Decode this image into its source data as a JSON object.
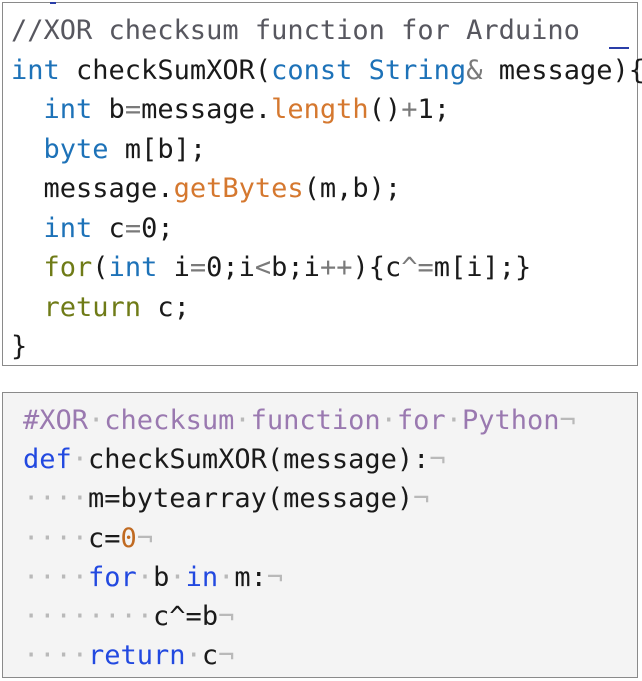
{
  "arduino": {
    "lines": [
      [
        {
          "t": "//XOR checksum function for Arduino",
          "c": "comment-ard"
        }
      ],
      [
        {
          "t": "int",
          "c": "kw-blue"
        },
        {
          "t": " checkSumXOR(",
          "c": ""
        },
        {
          "t": "const",
          "c": "kw-blue"
        },
        {
          "t": " ",
          "c": ""
        },
        {
          "t": "String",
          "c": "kw-blue"
        },
        {
          "t": "&",
          "c": "op-gray"
        },
        {
          "t": " message){",
          "c": ""
        }
      ],
      [
        {
          "t": "  ",
          "c": ""
        },
        {
          "t": "int",
          "c": "kw-blue"
        },
        {
          "t": " b",
          "c": ""
        },
        {
          "t": "=",
          "c": "op-gray"
        },
        {
          "t": "message.",
          "c": ""
        },
        {
          "t": "length",
          "c": "fn-orange"
        },
        {
          "t": "()",
          "c": ""
        },
        {
          "t": "+",
          "c": "op-gray"
        },
        {
          "t": "1;",
          "c": ""
        }
      ],
      [
        {
          "t": "  ",
          "c": ""
        },
        {
          "t": "byte",
          "c": "kw-blue"
        },
        {
          "t": " m[b];",
          "c": ""
        }
      ],
      [
        {
          "t": "  message.",
          "c": ""
        },
        {
          "t": "getBytes",
          "c": "fn-orange"
        },
        {
          "t": "(m,b);",
          "c": ""
        }
      ],
      [
        {
          "t": "  ",
          "c": ""
        },
        {
          "t": "int",
          "c": "kw-blue"
        },
        {
          "t": " c",
          "c": ""
        },
        {
          "t": "=",
          "c": "op-gray"
        },
        {
          "t": "0;",
          "c": ""
        }
      ],
      [
        {
          "t": "  ",
          "c": ""
        },
        {
          "t": "for",
          "c": "kw-olive"
        },
        {
          "t": "(",
          "c": ""
        },
        {
          "t": "int",
          "c": "kw-blue"
        },
        {
          "t": " i",
          "c": ""
        },
        {
          "t": "=",
          "c": "op-gray"
        },
        {
          "t": "0;i",
          "c": ""
        },
        {
          "t": "<",
          "c": "op-gray"
        },
        {
          "t": "b;i",
          "c": ""
        },
        {
          "t": "++",
          "c": "op-gray"
        },
        {
          "t": "){c",
          "c": ""
        },
        {
          "t": "^=",
          "c": "op-gray"
        },
        {
          "t": "m[i];}",
          "c": ""
        }
      ],
      [
        {
          "t": "  ",
          "c": ""
        },
        {
          "t": "return",
          "c": "kw-olive"
        },
        {
          "t": " c;",
          "c": ""
        }
      ],
      [
        {
          "t": "}",
          "c": ""
        }
      ]
    ]
  },
  "python": {
    "lines": [
      [
        {
          "t": "#XOR",
          "c": "comment-py"
        },
        {
          "t": "·",
          "c": "ws"
        },
        {
          "t": "checksum",
          "c": "comment-py"
        },
        {
          "t": "·",
          "c": "ws"
        },
        {
          "t": "function",
          "c": "comment-py"
        },
        {
          "t": "·",
          "c": "ws"
        },
        {
          "t": "for",
          "c": "comment-py"
        },
        {
          "t": "·",
          "c": "ws"
        },
        {
          "t": "Python",
          "c": "comment-py"
        },
        {
          "t": "¬",
          "c": "ws"
        }
      ],
      [
        {
          "t": "def",
          "c": "kw-py"
        },
        {
          "t": "·",
          "c": "ws"
        },
        {
          "t": "checkSumXOR(message):",
          "c": ""
        },
        {
          "t": "¬",
          "c": "ws"
        }
      ],
      [
        {
          "t": "····",
          "c": "ws"
        },
        {
          "t": "m=bytearray(message)",
          "c": ""
        },
        {
          "t": "¬",
          "c": "ws"
        }
      ],
      [
        {
          "t": "····",
          "c": "ws"
        },
        {
          "t": "c=",
          "c": ""
        },
        {
          "t": "0",
          "c": "num-py"
        },
        {
          "t": "¬",
          "c": "ws"
        }
      ],
      [
        {
          "t": "····",
          "c": "ws"
        },
        {
          "t": "for",
          "c": "kw-py"
        },
        {
          "t": "·",
          "c": "ws"
        },
        {
          "t": "b",
          "c": ""
        },
        {
          "t": "·",
          "c": "ws"
        },
        {
          "t": "in",
          "c": "kw-py"
        },
        {
          "t": "·",
          "c": "ws"
        },
        {
          "t": "m:",
          "c": ""
        },
        {
          "t": "¬",
          "c": "ws"
        }
      ],
      [
        {
          "t": "········",
          "c": "ws"
        },
        {
          "t": "c^=b",
          "c": ""
        },
        {
          "t": "¬",
          "c": "ws"
        }
      ],
      [
        {
          "t": "····",
          "c": "ws"
        },
        {
          "t": "return",
          "c": "kw-py"
        },
        {
          "t": "·",
          "c": "ws"
        },
        {
          "t": "c",
          "c": ""
        },
        {
          "t": "¬",
          "c": "ws"
        }
      ]
    ]
  }
}
